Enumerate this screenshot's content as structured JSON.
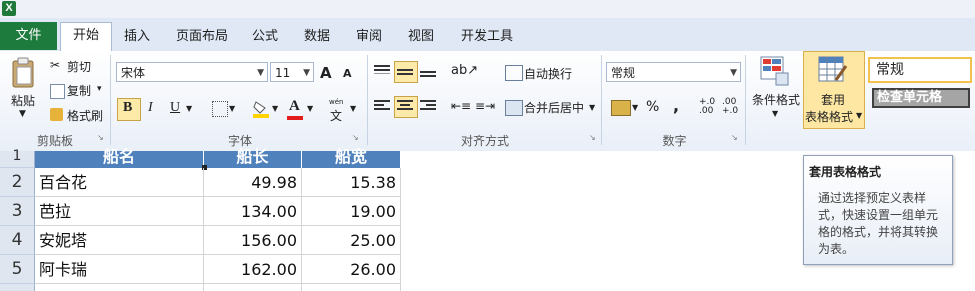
{
  "app": {
    "icon_letter": "X"
  },
  "tabs": [
    "文件",
    "开始",
    "插入",
    "页面布局",
    "公式",
    "数据",
    "审阅",
    "视图",
    "开发工具"
  ],
  "clipboard": {
    "paste": "粘贴",
    "cut": "剪切",
    "copy": "复制",
    "format_painter": "格式刷",
    "group": "剪贴板"
  },
  "font": {
    "name": "宋体",
    "size": "11",
    "grow": "A",
    "shrink": "A",
    "bold": "B",
    "italic": "I",
    "underline": "U",
    "font_color_glyph": "A",
    "phonetic_top": "wén",
    "phonetic_glyph": "文",
    "group": "字体"
  },
  "alignment": {
    "wrap": "自动换行",
    "merge": "合并后居中",
    "group": "对齐方式"
  },
  "number": {
    "format": "常规",
    "percent": "%",
    "comma": ",",
    "inc": "+.0\n.00",
    "dec": ".00\n+.0",
    "group": "数字"
  },
  "styles": {
    "conditional": "条件格式",
    "table_format_line1": "套用",
    "table_format_line2": "表格格式",
    "cell_style_normal": "常规",
    "cell_style_check": "检查单元格"
  },
  "tooltip": {
    "title": "套用表格格式",
    "body": "通过选择预定义表样式，快速设置一组单元格的格式，并将其转换为表。"
  },
  "sheet": {
    "header_row": "1",
    "headers": [
      "船名",
      "船长",
      "船宽"
    ],
    "rows": [
      {
        "num": "2",
        "name": "百合花",
        "length": "49.98",
        "width": "15.38"
      },
      {
        "num": "3",
        "name": "芭拉",
        "length": "134.00",
        "width": "19.00"
      },
      {
        "num": "4",
        "name": "安妮塔",
        "length": "156.00",
        "width": "25.00"
      },
      {
        "num": "5",
        "name": "阿卡瑞",
        "length": "162.00",
        "width": "26.00"
      }
    ]
  }
}
